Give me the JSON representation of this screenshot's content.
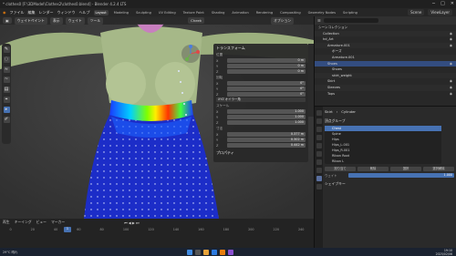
{
  "window": {
    "title": "* clothes0 [F:\\3DModel\\Clothes2\\clothes0.blend] - Blender 4.2.4 LTS"
  },
  "menubar": {
    "menus": [
      "ファイル",
      "編集",
      "レンダー",
      "ウィンドウ",
      "ヘルプ"
    ],
    "workspaces": [
      "Layout",
      "Modeling",
      "Sculpting",
      "UV Editing",
      "Texture Paint",
      "Shading",
      "Animation",
      "Rendering",
      "Compositing",
      "Geometry Nodes",
      "Scripting"
    ],
    "active_workspace": "Layout",
    "scene": "Scene",
    "view_layer": "ViewLayer"
  },
  "viewport": {
    "mode": "ウェイトペイント",
    "menus": [
      "表示",
      "ウェイト",
      "ツール"
    ],
    "brush": "Cheek",
    "options": "オプション"
  },
  "npanel": {
    "title": "トランスフォーム",
    "location_label": "位置",
    "location": [
      [
        "X",
        "0 m"
      ],
      [
        "Y",
        "0 m"
      ],
      [
        "Z",
        "0 m"
      ]
    ],
    "rotation_label": "回転",
    "rotation": [
      [
        "X",
        "0°"
      ],
      [
        "Y",
        "0°"
      ],
      [
        "Z",
        "0°"
      ]
    ],
    "rotation_mode": "XYZ オイラー角",
    "scale_label": "スケール",
    "scale": [
      [
        "X",
        "1.000"
      ],
      [
        "Y",
        "1.000"
      ],
      [
        "Z",
        "1.000"
      ]
    ],
    "dimensions_label": "寸法",
    "dimensions": [
      [
        "X",
        "0.377 m"
      ],
      [
        "Y",
        "0.302 m"
      ],
      [
        "Z",
        "0.442 m"
      ]
    ],
    "properties": "プロパティ"
  },
  "timeline": {
    "menus": [
      "再生",
      "キーイング",
      "ビュー",
      "マーカー"
    ],
    "current_frame": "1",
    "ticks": [
      "0",
      "20",
      "40",
      "60",
      "80",
      "100",
      "120",
      "140",
      "160",
      "180",
      "200",
      "220",
      "240"
    ]
  },
  "outliner": {
    "items": [
      {
        "label": "シーンコレクション",
        "indent": 0
      },
      {
        "label": "Collection",
        "indent": 1
      },
      {
        "label": "hd_Art",
        "indent": 1
      },
      {
        "label": "Armature.001",
        "indent": 2
      },
      {
        "label": "ポーズ",
        "indent": 3
      },
      {
        "label": "Armature.001",
        "indent": 3
      },
      {
        "label": "Shoes",
        "indent": 2,
        "selected": true
      },
      {
        "label": "Shoes",
        "indent": 3
      },
      {
        "label": "skirt_weight",
        "indent": 3
      },
      {
        "label": "Skirt",
        "indent": 2
      },
      {
        "label": "Sleeves",
        "indent": 2
      },
      {
        "label": "Tops",
        "indent": 2
      }
    ]
  },
  "properties": {
    "object": "Skirt",
    "mesh": "Cylinder",
    "vertex_groups_label": "頂点グループ",
    "vertex_groups": [
      "Chest",
      "Spine",
      "Hips",
      "Hips_L.001",
      "Hips_R.001",
      "Ribon Root",
      "Ribon L"
    ],
    "selected_group": "Chest",
    "buttons": [
      "割り当て",
      "削除",
      "選択",
      "選択解除"
    ],
    "weight_label": "ウェイト",
    "weight_value": "1.000",
    "shape_keys_label": "シェイプキー"
  },
  "taskbar": {
    "weather": "29°C 晴れ",
    "time": "19:10",
    "date": "2025/02/06"
  }
}
